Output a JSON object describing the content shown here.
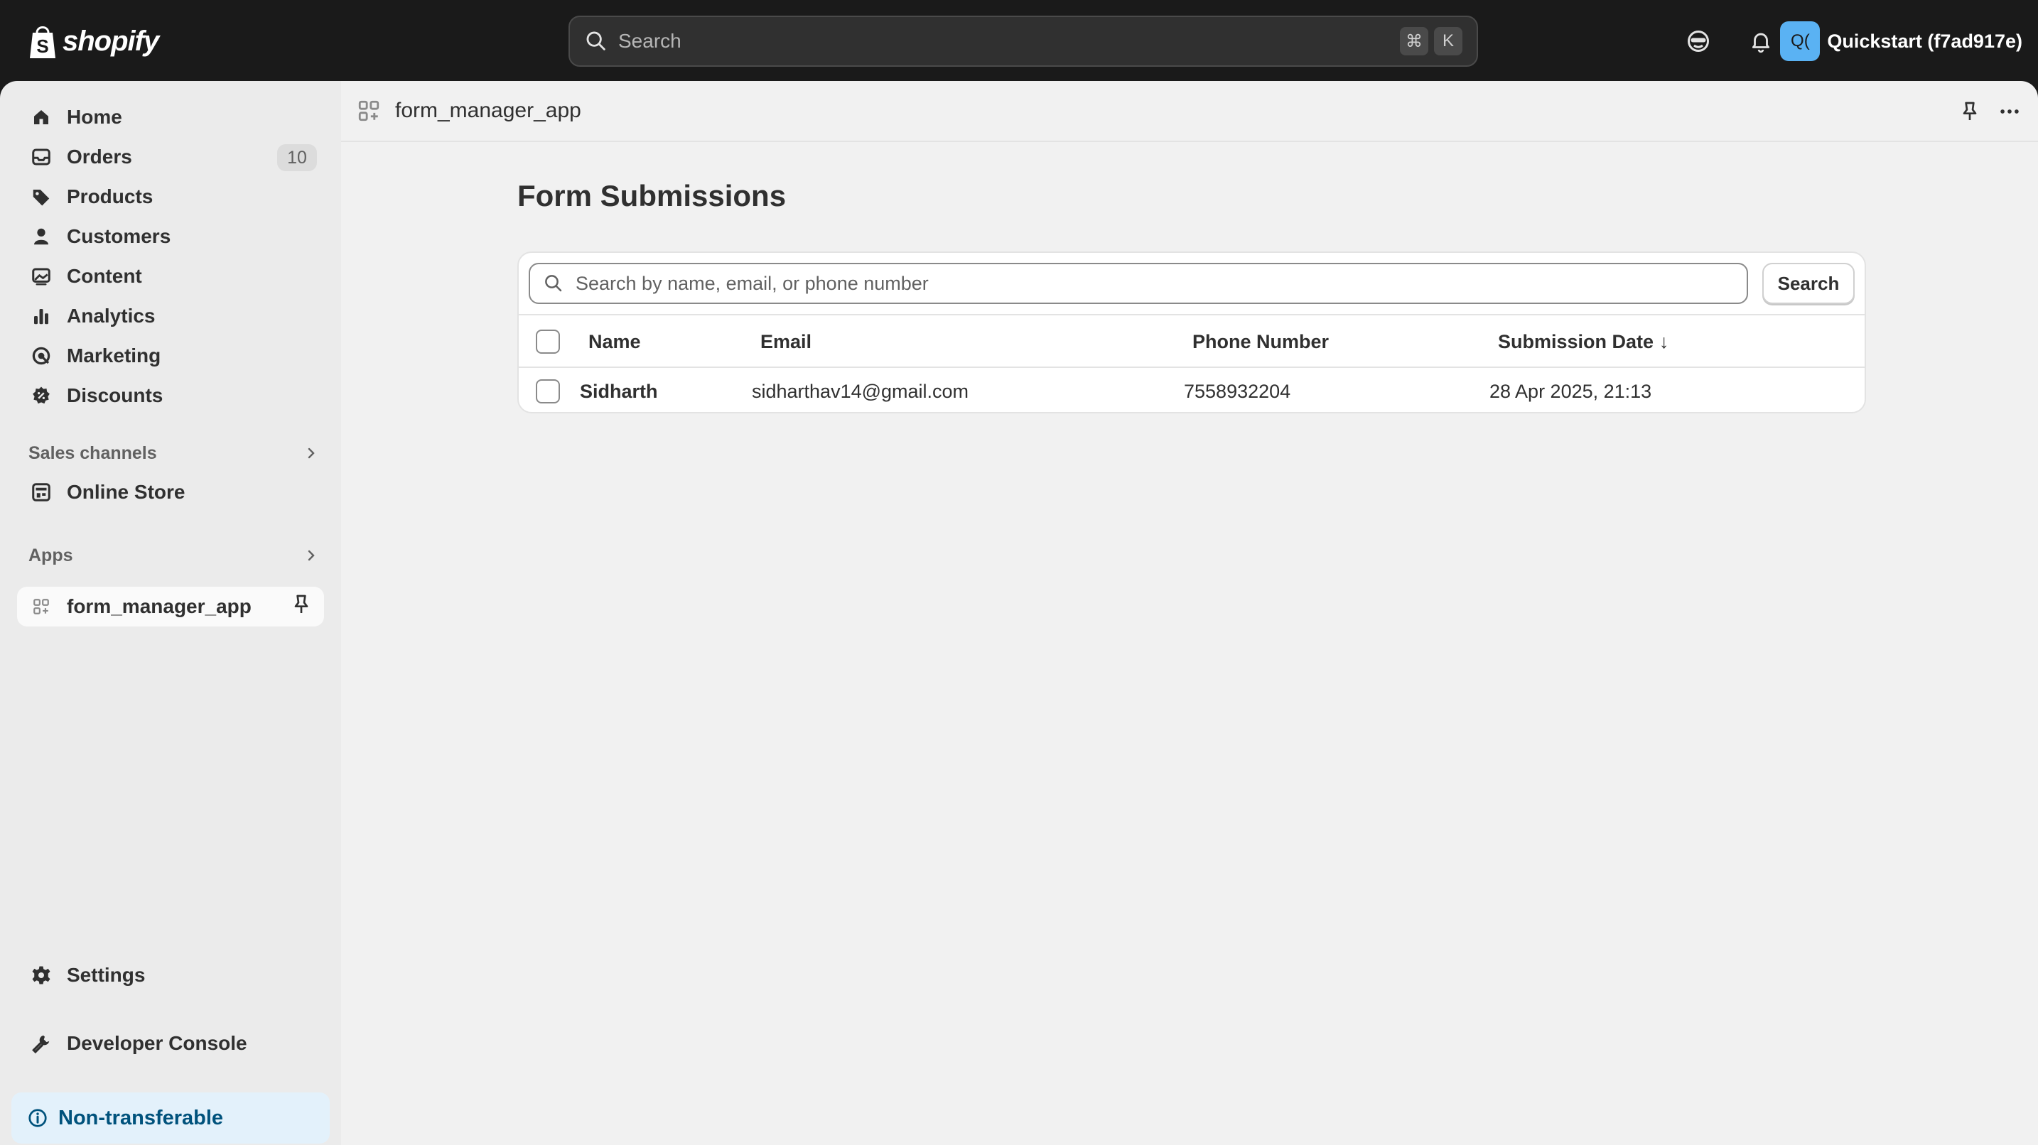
{
  "topbar": {
    "logo_text": "shopify",
    "search_placeholder": "Search",
    "shortcut_cmd": "⌘",
    "shortcut_key": "K",
    "account_initials": "Q(",
    "account_name": "Quickstart (f7ad917e)"
  },
  "sidebar": {
    "items": [
      {
        "label": "Home",
        "icon": "home-icon"
      },
      {
        "label": "Orders",
        "icon": "orders-icon",
        "badge": "10"
      },
      {
        "label": "Products",
        "icon": "tag-icon"
      },
      {
        "label": "Customers",
        "icon": "person-icon"
      },
      {
        "label": "Content",
        "icon": "image-icon"
      },
      {
        "label": "Analytics",
        "icon": "bar-chart-icon"
      },
      {
        "label": "Marketing",
        "icon": "target-icon"
      },
      {
        "label": "Discounts",
        "icon": "discount-icon"
      }
    ],
    "sales_channels_label": "Sales channels",
    "online_store_label": "Online Store",
    "apps_label": "Apps",
    "app_item_label": "form_manager_app",
    "settings_label": "Settings",
    "developer_console_label": "Developer Console",
    "notice_label": "Non-transferable"
  },
  "app_header": {
    "title": "form_manager_app"
  },
  "page": {
    "title": "Form Submissions",
    "search_placeholder": "Search by name, email, or phone number",
    "search_button": "Search",
    "columns": [
      "Name",
      "Email",
      "Phone Number",
      "Submission Date"
    ],
    "sort_indicator": "↓",
    "rows": [
      {
        "name": "Sidharth",
        "email": "sidharthav14@gmail.com",
        "phone": "7558932204",
        "date": "28 Apr 2025, 21:13"
      }
    ]
  },
  "colors": {
    "topbar_bg": "#1a1a1a",
    "sidebar_bg": "#ebebeb",
    "main_bg": "#f1f1f1",
    "avatar_bg": "#5ab2f3",
    "notice_bg": "#e3f1fb",
    "notice_text": "#00527c"
  }
}
